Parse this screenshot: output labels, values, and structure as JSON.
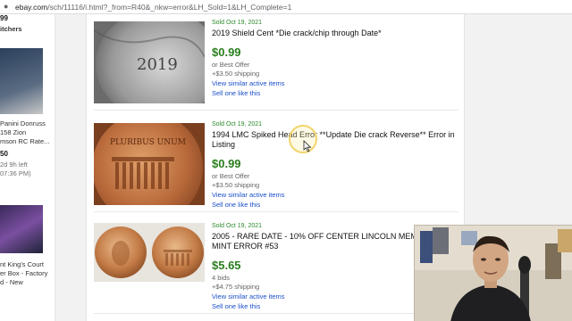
{
  "browser": {
    "url_host": "ebay.com",
    "url_path": "/sch/11116/i.html?_from=R40&_nkw=error&LH_Sold=1&LH_Complete=1"
  },
  "left_column": {
    "top_fragment_a": "99",
    "top_fragment_b": "itchers",
    "card2": {
      "line1": "Panini Donruss",
      "line2": "158 Zion",
      "line3": "mson RC Rate...",
      "price": "50",
      "time1": "2d 9h left",
      "time2": "07:36 PM)"
    },
    "card3": {
      "line1": "nt King's Court",
      "line2": "er Box - Factory",
      "line3": "d - New"
    }
  },
  "listings": [
    {
      "sold_date": "Sold Oct 19, 2021",
      "title": "2019 Shield Cent *Die crack/chip through Date*",
      "price": "$0.99",
      "offer": "or Best Offer",
      "shipping": "+$3.50 shipping",
      "similar_link": "View similar active items",
      "sell_link": "Sell one like this",
      "coin_text": "2019"
    },
    {
      "sold_date": "Sold Oct 19, 2021",
      "title": "1994 LMC Spiked Head Error **Update Die crack Reverse** Error in Listing",
      "price": "$0.99",
      "offer": "or Best Offer",
      "shipping": "+$3.50 shipping",
      "similar_link": "View similar active items",
      "sell_link": "Sell one like this",
      "coin_text": "PLURIBUS UNUM"
    },
    {
      "sold_date": "Sold Oct 19, 2021",
      "title": "2005 - RARE DATE - 10% OFF CENTER LINCOLN MEMO MAJOR MINT ERROR #53",
      "price": "$5.65",
      "offer": "4 bids",
      "shipping": "+$4.75 shipping",
      "similar_link": "View similar active items",
      "sell_link": "Sell one like this"
    }
  ],
  "colors": {
    "sold_green": "#2a8a2a",
    "price_green": "#2a7f1e",
    "link_blue": "#1a4ec9"
  }
}
